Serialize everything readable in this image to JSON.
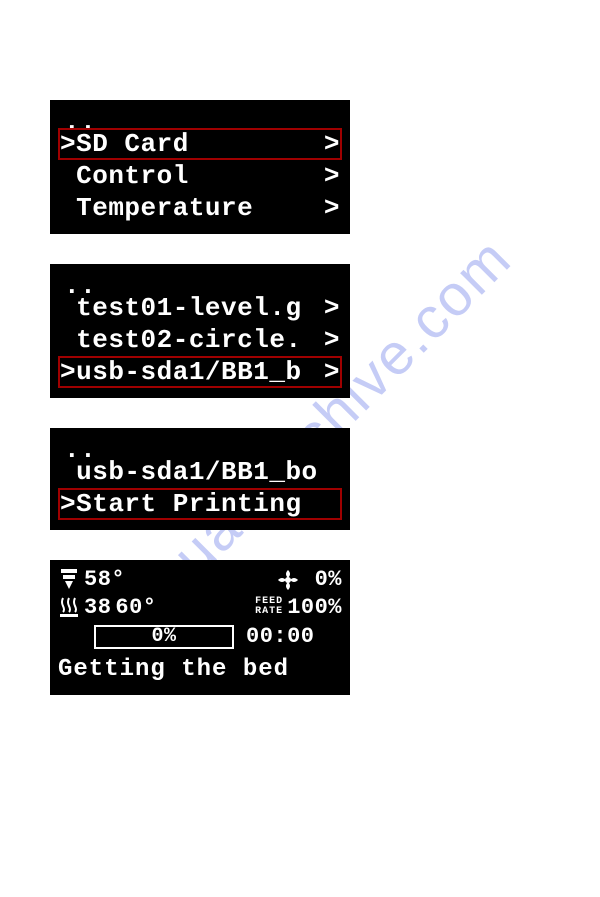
{
  "watermark": "manualsarchive.com",
  "screen1": {
    "parent": "..",
    "items": [
      {
        "label": "SD Card",
        "prefix": ">",
        "arrow": ">",
        "selected": true
      },
      {
        "label": "Control",
        "prefix": " ",
        "arrow": ">",
        "selected": false
      },
      {
        "label": "Temperature",
        "prefix": " ",
        "arrow": ">",
        "selected": false
      }
    ]
  },
  "screen2": {
    "parent": "..",
    "items": [
      {
        "label": "test01-level.g",
        "prefix": " ",
        "arrow": ">",
        "selected": false
      },
      {
        "label": "test02-circle.",
        "prefix": " ",
        "arrow": ">",
        "selected": false
      },
      {
        "label": "usb-sda1/BB1_b",
        "prefix": ">",
        "arrow": ">",
        "selected": true
      }
    ]
  },
  "screen3": {
    "parent": "..",
    "items": [
      {
        "label": "usb-sda1/BB1_bo",
        "prefix": " ",
        "arrow": "",
        "selected": false
      },
      {
        "label": "Start Printing",
        "prefix": ">",
        "arrow": "",
        "selected": true
      }
    ]
  },
  "status": {
    "nozzle_temp": "58°",
    "bed_actual": "38",
    "bed_target": "60°",
    "fan_pct": "0%",
    "feed_label_top": "FEED",
    "feed_label_bot": "RATE",
    "feed_pct": "100%",
    "progress_pct": "0%",
    "elapsed": "00:00",
    "message": "Getting the bed"
  }
}
